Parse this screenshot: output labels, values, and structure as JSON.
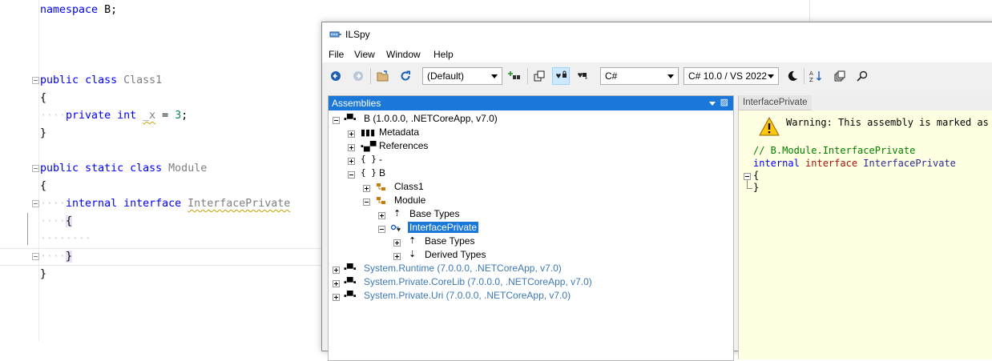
{
  "editor": {
    "lines": {
      "ns_kw": "namespace",
      "ns_name": "B;",
      "c1_kw1": "public",
      "c1_kw2": "class",
      "c1_name": "Class1",
      "open1": "{",
      "fld_kw1": "private",
      "fld_kw2": "int",
      "fld_name": "_x",
      "fld_eq": "=",
      "fld_val": "3",
      "fld_semi": ";",
      "close1": "}",
      "m_kw1": "public",
      "m_kw2": "static",
      "m_kw3": "class",
      "m_name": "Module",
      "open2": "{",
      "i_kw1": "internal",
      "i_kw2": "interface",
      "i_name": "InterfacePrivate",
      "open3": "{",
      "close3": "}",
      "close2": "}"
    }
  },
  "ilspy": {
    "title": "ILSpy",
    "menu": [
      "File",
      "View",
      "Window",
      "Help"
    ],
    "toolbar": {
      "assembly_list": "(Default)",
      "language": "C#",
      "language_version": "C# 10.0 / VS 2022"
    },
    "assemblies_panel": {
      "title": "Assemblies",
      "pin": "▨"
    },
    "tree": [
      {
        "label": "B (1.0.0.0, .NETCoreApp, v7.0)"
      },
      {
        "label": "Metadata"
      },
      {
        "label": "References"
      },
      {
        "label": "-"
      },
      {
        "label": "B"
      },
      {
        "label": "Class1"
      },
      {
        "label": "Module"
      },
      {
        "label": "Base Types"
      },
      {
        "label": "InterfacePrivate"
      },
      {
        "label": "Base Types"
      },
      {
        "label": "Derived Types"
      },
      {
        "label": "System.Runtime (7.0.0.0, .NETCoreApp, v7.0)"
      },
      {
        "label": "System.Private.CoreLib (7.0.0.0, .NETCoreApp, v7.0)"
      },
      {
        "label": "System.Private.Uri (7.0.0.0, .NETCoreApp, v7.0)"
      }
    ],
    "decompiled": {
      "tab": "InterfacePrivate",
      "warning": "Warning: This assembly is marked as '",
      "comment": "// B.Module.InterfacePrivate",
      "decl_kw1": "internal",
      "decl_kw2": "interface",
      "decl_name": "InterfacePrivate",
      "open": "{",
      "close": "}"
    }
  }
}
